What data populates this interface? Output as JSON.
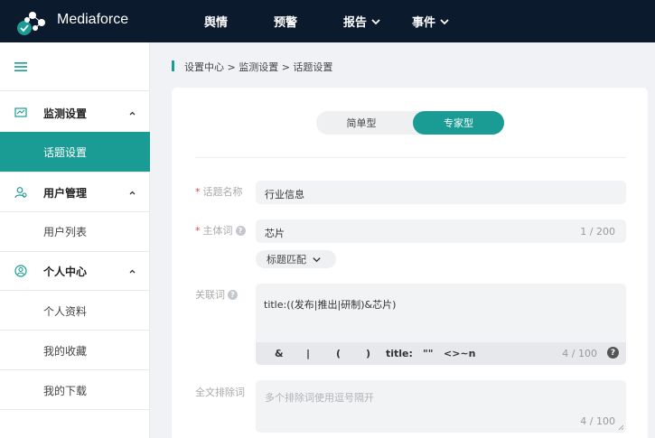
{
  "header": {
    "brand": "Mediaforce",
    "nav": [
      {
        "label": "舆情"
      },
      {
        "label": "预警"
      },
      {
        "label": "报告"
      },
      {
        "label": "事件"
      }
    ]
  },
  "sidebar": {
    "groups": [
      {
        "label": "监测设置",
        "icon": "monitor-chart-icon",
        "items": [
          {
            "label": "话题设置",
            "active": true
          }
        ]
      },
      {
        "label": "用户管理",
        "icon": "users-icon",
        "items": [
          {
            "label": "用户列表"
          }
        ]
      },
      {
        "label": "个人中心",
        "icon": "user-circle-icon",
        "items": [
          {
            "label": "个人资料"
          },
          {
            "label": "我的收藏"
          },
          {
            "label": "我的下载"
          }
        ]
      }
    ]
  },
  "breadcrumb": "设置中心 > 监测设置 > 话题设置",
  "mode_toggle": {
    "simple": "简单型",
    "expert": "专家型",
    "selected": "专家型"
  },
  "form": {
    "topic_name": {
      "label": "话题名称",
      "value": "行业信息"
    },
    "subject": {
      "label": "主体词",
      "value": "芯片",
      "count": "1 / 200"
    },
    "match_mode": {
      "value": "标题匹配"
    },
    "related": {
      "label": "关联词",
      "value": "title:((发布|推出|研制)&芯片)",
      "operators": [
        "&",
        "|",
        "(",
        ")",
        "title:",
        "\"\"",
        "<>~n"
      ],
      "count": "4 / 100"
    },
    "exclude": {
      "label": "全文排除词",
      "placeholder": "多个排除词使用逗号隔开",
      "count": "4 / 100"
    }
  },
  "colors": {
    "accent": "#1a9b94",
    "header_bg": "#0c1a2e",
    "required": "#e04848"
  }
}
